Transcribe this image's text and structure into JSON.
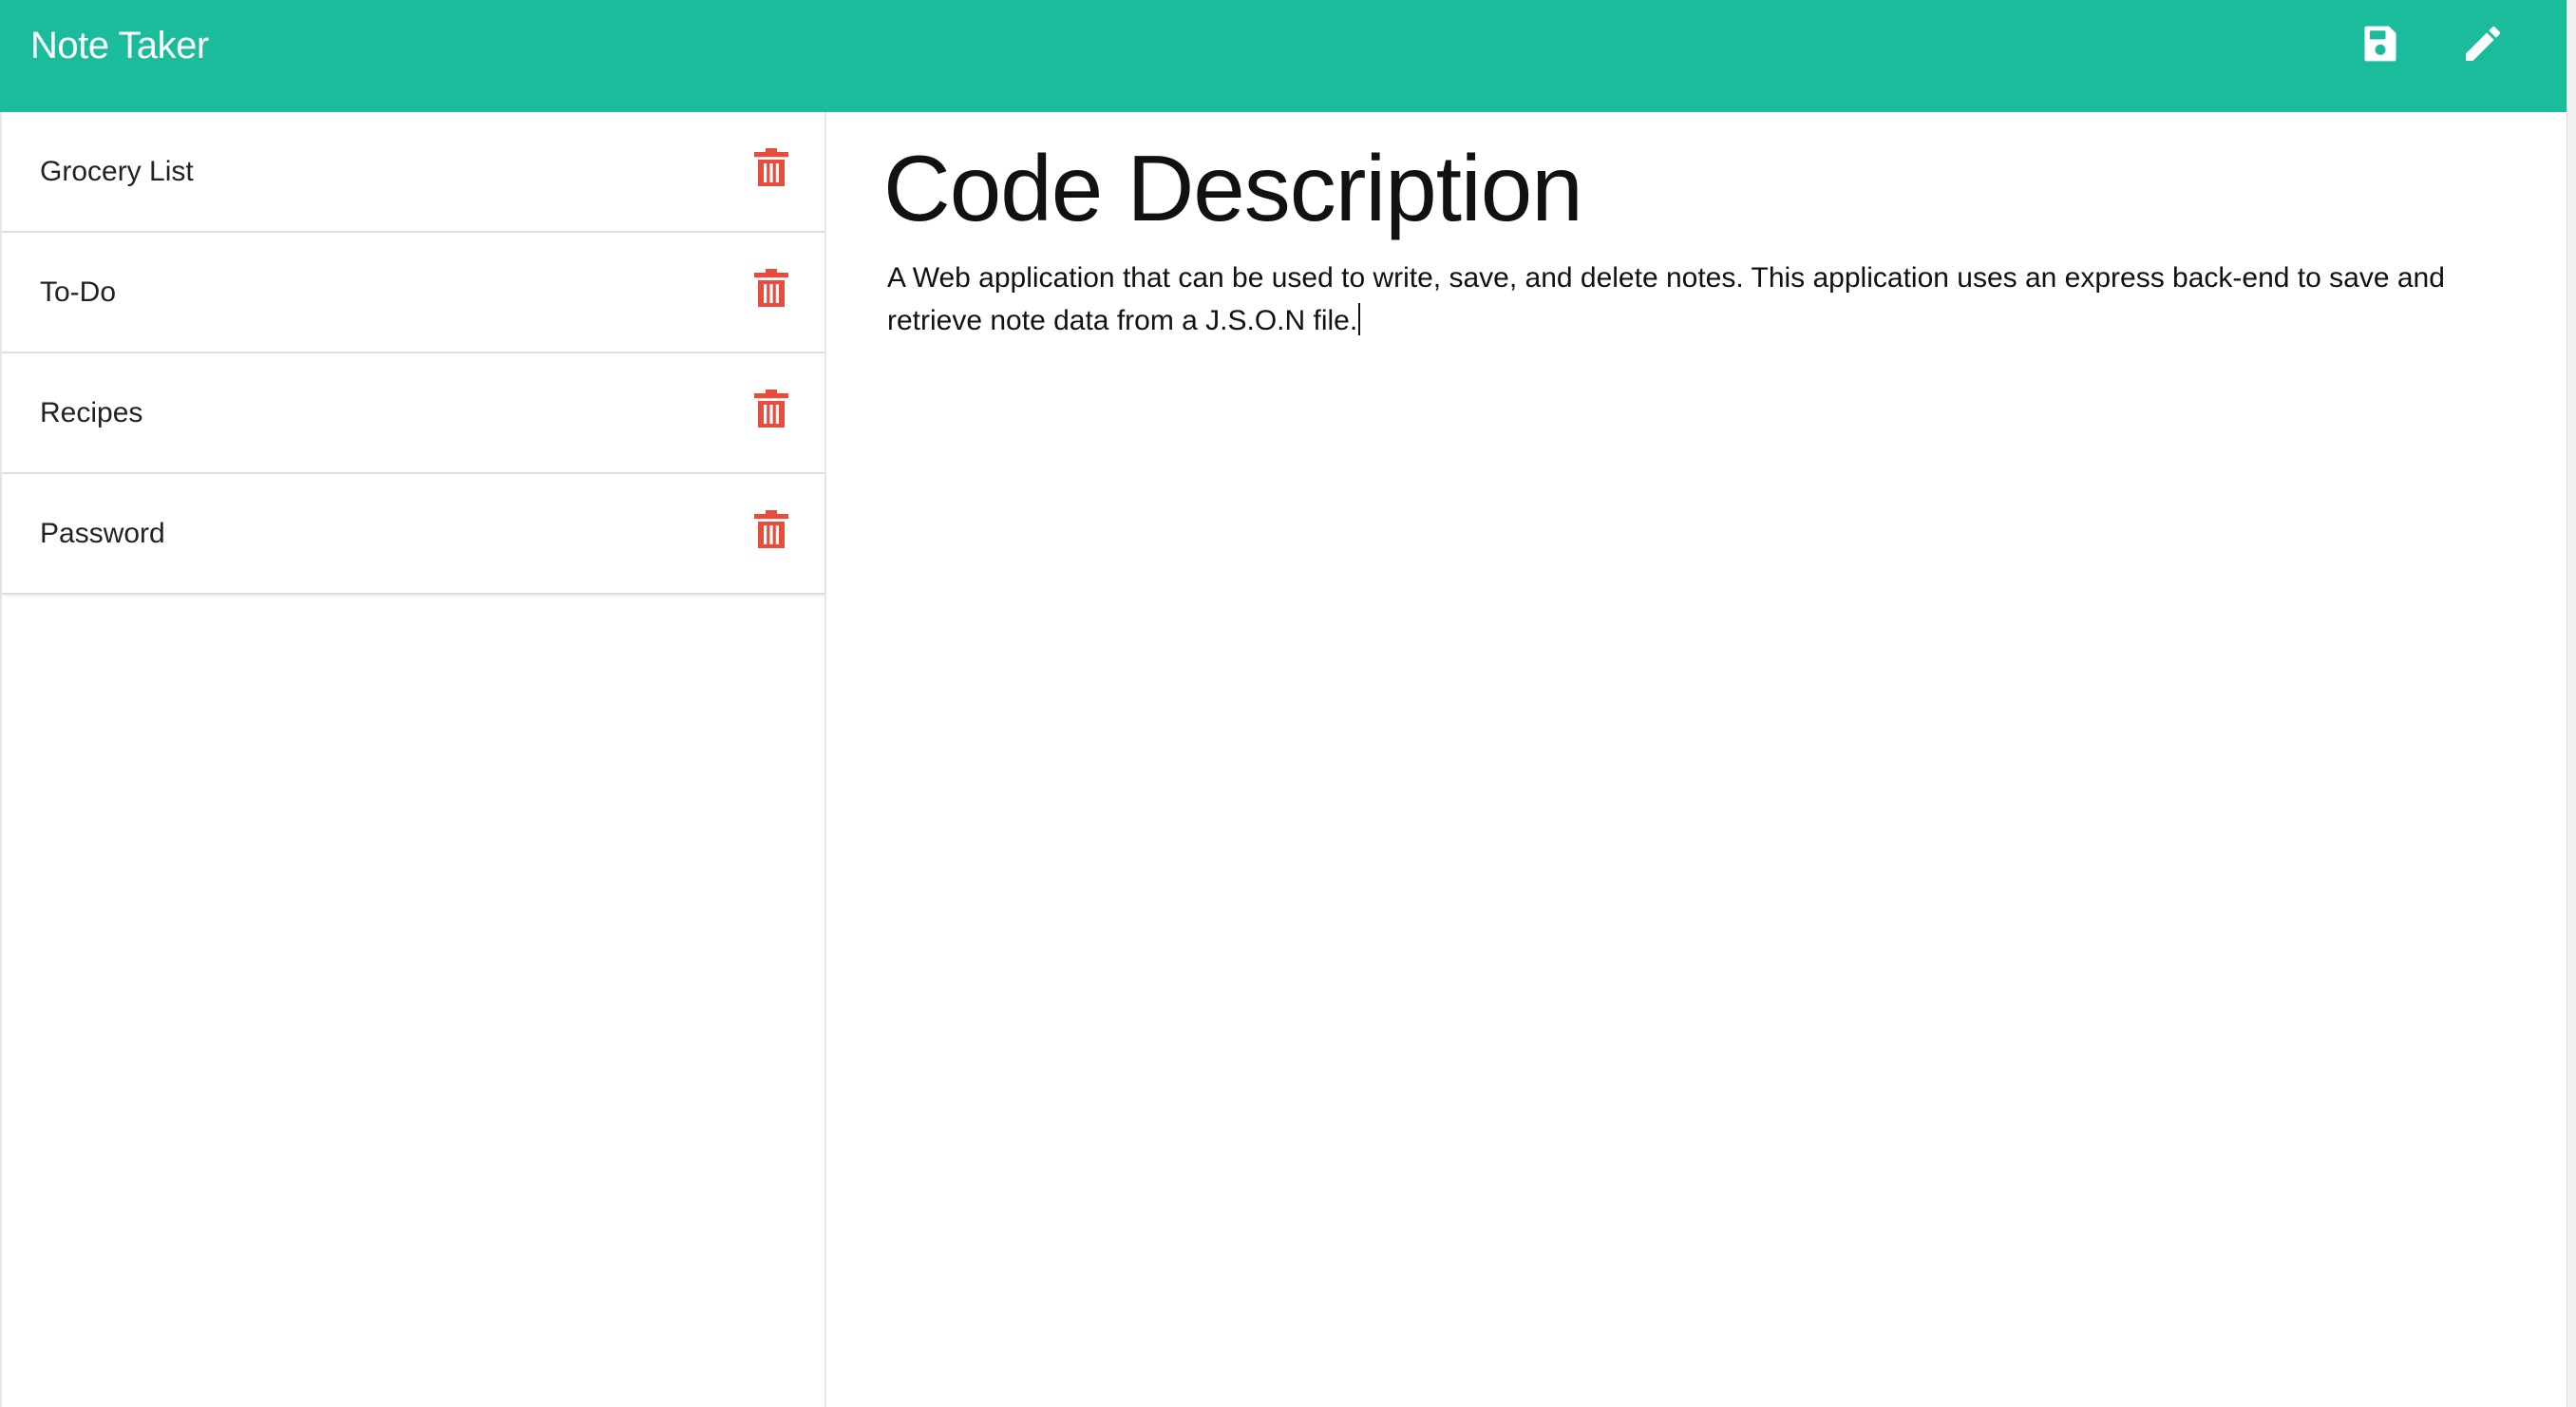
{
  "app": {
    "title": "Note Taker"
  },
  "toolbar": {
    "save_icon": "save-icon",
    "new_note_icon": "pencil-icon"
  },
  "colors": {
    "navbar": "#1abc9c",
    "delete": "#e74c3c",
    "text": "#111111"
  },
  "sidebar": {
    "notes": [
      {
        "title": "Grocery List",
        "icon": "trash-icon"
      },
      {
        "title": "To-Do",
        "icon": "trash-icon"
      },
      {
        "title": "Recipes",
        "icon": "trash-icon"
      },
      {
        "title": "Password",
        "icon": "trash-icon"
      }
    ]
  },
  "editor": {
    "title": "Code Description",
    "body": "A Web application that can be used to write, save, and delete notes. This application uses an express back-end to save and retrieve note data from a J.S.O.N file."
  }
}
